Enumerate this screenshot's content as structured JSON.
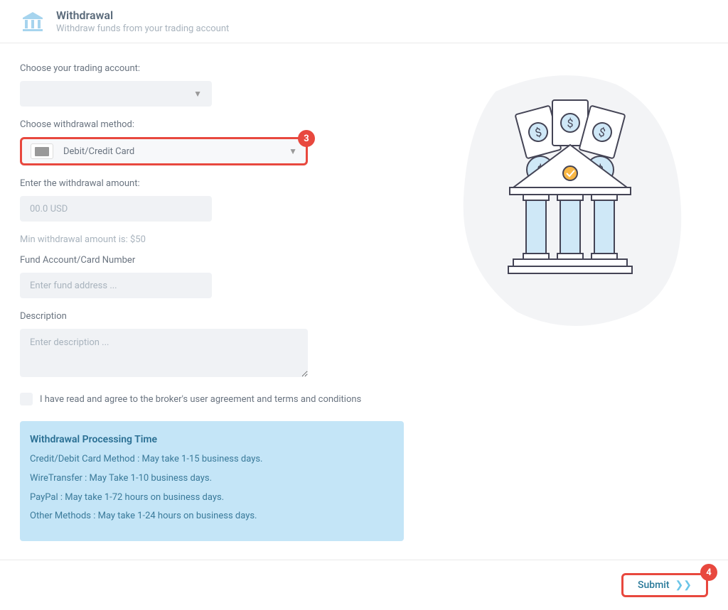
{
  "header": {
    "title": "Withdrawal",
    "subtitle": "Withdraw funds from your trading account"
  },
  "form": {
    "account_label": "Choose your trading account:",
    "method_label": "Choose withdrawal method:",
    "method_selected": "Debit/Credit Card",
    "method_badge": "3",
    "amount_label": "Enter the withdrawal amount:",
    "amount_placeholder": "00.0 USD",
    "amount_hint": "Min withdrawal amount is: $50",
    "fund_label": "Fund Account/Card Number",
    "fund_placeholder": "Enter fund address ...",
    "description_label": "Description",
    "description_placeholder": "Enter description ...",
    "agreement_label": "I have read and agree to the broker's user agreement and terms and conditions"
  },
  "info_box": {
    "title": "Withdrawal Processing Time",
    "lines": [
      "Credit/Debit Card Method : May take 1-15 business days.",
      "WireTransfer : May Take 1-10 business days.",
      "PayPal : May take 1-72 hours on business days.",
      "Other Methods : May take 1-24 hours on business days."
    ]
  },
  "footer": {
    "submit_label": "Submit",
    "submit_badge": "4"
  }
}
